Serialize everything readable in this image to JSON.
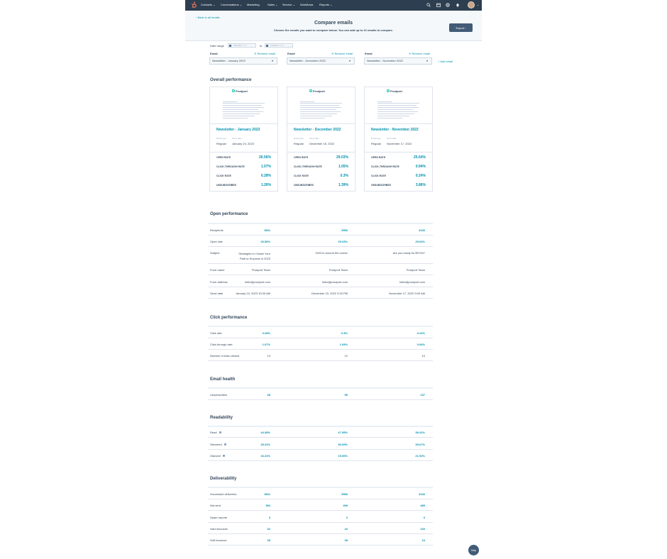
{
  "nav": {
    "items": [
      "Contacts",
      "Conversations",
      "Marketing",
      "Sales",
      "Service",
      "Workflows",
      "Reports"
    ],
    "carets": [
      "⌄",
      "⌄",
      "",
      "⌄",
      "⌄",
      "",
      "⌄"
    ],
    "icons": [
      "search-icon",
      "marketplace-icon",
      "settings-icon",
      "notifications-icon"
    ]
  },
  "header": {
    "back_link": "‹ Back to all emails",
    "title": "Compare emails",
    "subtitle": "Choose the emails you want to compare below. You can add up to 10 emails to compare.",
    "export_label": "Export ›"
  },
  "filters": {
    "date_range_label": "Date range",
    "date_from_placeholder": "MM/DD/YYYY",
    "date_to_label": "to",
    "date_to_placeholder": "MM/DD/YYYY",
    "email_label": "Email",
    "remove_label": "Remove email",
    "add_email_label": "+ Add email",
    "selected": [
      "Newsletter - January 2023",
      "Newsletter - December 2022",
      "Newsletter - November 2022"
    ]
  },
  "overall": {
    "title": "Overall performance",
    "cards": [
      {
        "brand": "Prodport",
        "name": "Newsletter - January 2023",
        "type_label": "Email type",
        "type": "Regular",
        "send_label": "Send date",
        "send_date": "January 24, 2023",
        "stats": [
          {
            "label": "OPEN RATE",
            "value": "26.56%"
          },
          {
            "label": "CLICK-THROUGH RATE",
            "value": "1.07%"
          },
          {
            "label": "CLICK RATE",
            "value": "0.28%"
          },
          {
            "label": "UNSUBSCRIBES",
            "value": "1.26%"
          }
        ]
      },
      {
        "brand": "Prodport",
        "name": "Newsletter - December 2022",
        "type_label": "Email type",
        "type": "Regular",
        "send_label": "Send date",
        "send_date": "December 15, 2022",
        "stats": [
          {
            "label": "OPEN RATE",
            "value": "29.03%"
          },
          {
            "label": "CLICK-THROUGH RATE",
            "value": "1.05%"
          },
          {
            "label": "CLICK RATE",
            "value": "0.3%"
          },
          {
            "label": "UNSUBSCRIBES",
            "value": "1.39%"
          }
        ]
      },
      {
        "brand": "Prodport",
        "name": "Newsletter - November 2022",
        "type_label": "Email type",
        "type": "Regular",
        "send_label": "Send date",
        "send_date": "November 17, 2022",
        "stats": [
          {
            "label": "OPEN RATE",
            "value": "25.64%"
          },
          {
            "label": "CLICK-THROUGH RATE",
            "value": "0.94%"
          },
          {
            "label": "CLICK RATE",
            "value": "0.24%"
          },
          {
            "label": "UNSUBSCRIBES",
            "value": "3.86%"
          }
        ]
      }
    ]
  },
  "open_performance": {
    "title": "Open performance",
    "rows": [
      {
        "label": "Recipients",
        "values": [
          "3811",
          "3966",
          "4136"
        ],
        "style": "link"
      },
      {
        "label": "Open rate",
        "values": [
          "26.56%",
          "29.03%",
          "25.64%"
        ],
        "style": "link"
      },
      {
        "label": "Subject",
        "values": [
          "Strategies to Create Your Path to Success in 2023",
          "2023 is around the corner",
          "Are you ready for BFCM?"
        ],
        "style": "text"
      },
      {
        "label": "From name",
        "values": [
          "Prodport Team",
          "Prodport Team",
          "Prodport Team"
        ],
        "style": "text"
      },
      {
        "label": "From address",
        "values": [
          "hello@prodport.com",
          "hello@prodport.com",
          "hello@prodport.com"
        ],
        "style": "text"
      },
      {
        "label": "Send date",
        "values": [
          "January 24, 2023 10:00 AM",
          "December 15, 2022 3:33 PM",
          "November 17, 2022 9:00 AM"
        ],
        "style": "text"
      }
    ]
  },
  "click_performance": {
    "title": "Click performance",
    "rows": [
      {
        "label": "Click rate",
        "values": [
          "0.28%",
          "0.3%",
          "0.24%"
        ],
        "style": "link"
      },
      {
        "label": "Click-through rate",
        "values": [
          "1.07%",
          "1.05%",
          "0.94%"
        ],
        "style": "link"
      },
      {
        "label": "Number of links clicked",
        "values": [
          "13",
          "12",
          "10"
        ],
        "style": "text"
      }
    ]
  },
  "email_health": {
    "title": "Email health",
    "rows": [
      {
        "label": "Unsubscribes",
        "values": [
          "48",
          "55",
          "137"
        ],
        "style": "link"
      }
    ]
  },
  "readability": {
    "title": "Readability",
    "rows": [
      {
        "label": "Read",
        "values": [
          "44.38%",
          "47.95%",
          "38.41%"
        ],
        "style": "link"
      },
      {
        "label": "Skimmed",
        "values": [
          "39.31%",
          "36.09%",
          "39.67%"
        ],
        "style": "link"
      },
      {
        "label": "Glanced",
        "values": [
          "16.31%",
          "15.96%",
          "21.92%"
        ],
        "style": "link"
      }
    ]
  },
  "deliverability": {
    "title": "Deliverability",
    "rows": [
      {
        "label": "Successful deliveries",
        "values": [
          "3811",
          "3966",
          "4136"
        ],
        "style": "link"
      },
      {
        "label": "Not sent",
        "values": [
          "354",
          "499",
          "489"
        ],
        "style": "link"
      },
      {
        "label": "Spam reports",
        "values": [
          "3",
          "3",
          "0"
        ],
        "style": "link"
      },
      {
        "label": "Hard bounces",
        "values": [
          "32",
          "43",
          "100"
        ],
        "style": "link"
      },
      {
        "label": "Soft bounces",
        "values": [
          "35",
          "38",
          "24"
        ],
        "style": "link"
      }
    ]
  },
  "help_label": "Help"
}
